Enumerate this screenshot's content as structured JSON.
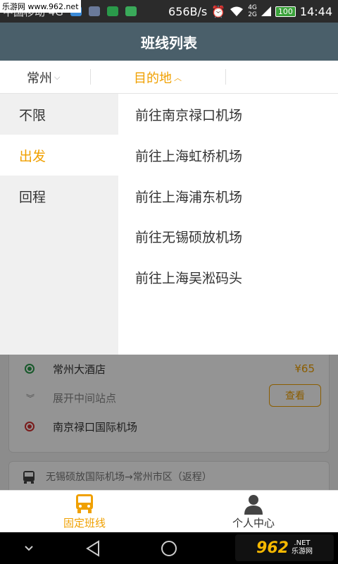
{
  "status_bar": {
    "watermark": "乐游网 www.962.net",
    "carrier": "中国移动 4G",
    "speed": "656B/s",
    "network": "4G",
    "network2": "2G",
    "battery": "100",
    "time": "14:44"
  },
  "header": {
    "title": "班线列表"
  },
  "filter": {
    "city_label": "常州",
    "city_chevron": "⌵",
    "dest_label": "目的地",
    "dest_chevron": "︿"
  },
  "dropdown": {
    "directions": [
      {
        "label": "不限"
      },
      {
        "label": "出发",
        "selected": true
      },
      {
        "label": "回程"
      }
    ],
    "destinations": [
      {
        "label": "前往南京禄口机场"
      },
      {
        "label": "前往上海虹桥机场"
      },
      {
        "label": "前往上海浦东机场"
      },
      {
        "label": "前往无锡硕放机场"
      },
      {
        "label": "前往上海吴淞码头"
      }
    ]
  },
  "routes": [
    {
      "start": "常州大酒店",
      "price": "¥65",
      "expand": "展开中间站点",
      "check": "查看",
      "end": "南京禄口国际机场"
    },
    {
      "name": "无锡硕放国际机场→常州市区（返程）"
    }
  ],
  "bottom_nav": {
    "bus_label": "固定班线",
    "me_label": "个人中心"
  },
  "watermark_bottom": {
    "big": "962",
    "small1": ".NET",
    "small2": "乐游网"
  },
  "colors": {
    "accent": "#f0a000",
    "header": "#4a5f6a",
    "start_dot": "#2a9a4a",
    "end_dot": "#d03030"
  }
}
